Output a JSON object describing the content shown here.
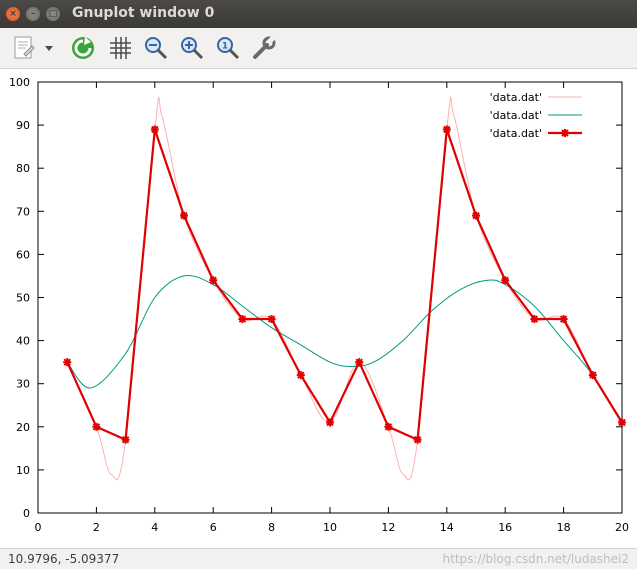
{
  "window": {
    "title": "Gnuplot window 0",
    "close_glyph": "×",
    "min_glyph": "–",
    "max_glyph": "□"
  },
  "toolbar": {
    "icons": [
      "copy-to-clipboard-icon",
      "dropdown-arrow-icon",
      "replot-icon",
      "grid-icon",
      "zoom-out-icon",
      "zoom-in-icon",
      "unzoom-icon",
      "config-wrench-icon"
    ]
  },
  "status": {
    "coords": "10.9796, -5.09377",
    "watermark": "https://blog.csdn.net/ludashei2"
  },
  "colors": {
    "thin_red": "#ffb0b0",
    "teal": "#009a80",
    "red": "#e00000"
  },
  "chart_data": {
    "type": "line",
    "title": "",
    "xlabel": "",
    "ylabel": "",
    "xlim": [
      0,
      20
    ],
    "ylim": [
      0,
      100
    ],
    "xticks": [
      0,
      2,
      4,
      6,
      8,
      10,
      12,
      14,
      16,
      18,
      20
    ],
    "yticks": [
      0,
      10,
      20,
      30,
      40,
      50,
      60,
      70,
      80,
      90,
      100
    ],
    "legend_position": "top-right",
    "series": [
      {
        "name": "'data.dat'",
        "style": "thin-smooth",
        "x": [
          1,
          2,
          2.5,
          3,
          4,
          4.25,
          5,
          6,
          7,
          8,
          9,
          10,
          11,
          12,
          12.5,
          13,
          14,
          14.25,
          15,
          16,
          17,
          18,
          19,
          20
        ],
        "values": [
          35,
          20,
          9,
          17,
          89,
          92,
          69,
          54,
          45,
          45,
          32,
          21,
          35,
          20,
          9,
          17,
          89,
          92,
          69,
          54,
          45,
          45,
          32,
          21
        ]
      },
      {
        "name": "'data.dat'",
        "style": "smooth-trend",
        "x": [
          1,
          1.8,
          3,
          4,
          5,
          6,
          7,
          8,
          9,
          10,
          10.7,
          11.5,
          12.5,
          13.5,
          14.5,
          15.4,
          16,
          17,
          18,
          19,
          20
        ],
        "values": [
          35,
          29,
          37,
          50,
          55,
          53,
          48,
          43,
          39,
          35,
          34,
          35,
          40,
          47,
          52,
          54,
          53,
          48,
          40,
          32,
          21
        ]
      },
      {
        "name": "'data.dat'",
        "style": "lines-points",
        "x": [
          1,
          2,
          3,
          4,
          5,
          6,
          7,
          8,
          9,
          10,
          11,
          12,
          13,
          14,
          15,
          16,
          17,
          18,
          19,
          20
        ],
        "values": [
          35,
          20,
          17,
          89,
          69,
          54,
          45,
          45,
          32,
          21,
          35,
          20,
          17,
          89,
          69,
          54,
          45,
          45,
          32,
          21
        ]
      }
    ]
  }
}
